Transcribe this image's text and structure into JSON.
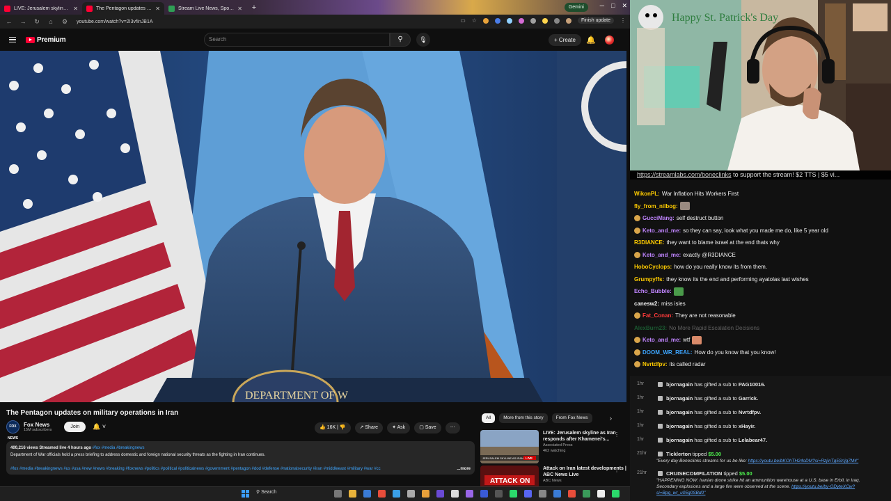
{
  "browser": {
    "tabs": [
      {
        "label": "LIVE: Jerusalem skyline as Iran",
        "active": false
      },
      {
        "label": "The Pentagon updates on m",
        "active": true
      },
      {
        "label": "Stream Live News, Sports,",
        "active": false
      }
    ],
    "gemini_label": "Gemini",
    "url": "youtube.com/watch?v=2I3vfInJB1A",
    "finish_update": "Finish update"
  },
  "youtube": {
    "logo_text": "Premium",
    "search_placeholder": "Search",
    "create_label": "Create"
  },
  "video": {
    "title": "The Pentagon updates on military operations in Iran",
    "seal_text": "DEPARTMENT OF W"
  },
  "channel": {
    "logo_text": "FOX NEWS",
    "name": "Fox News",
    "subscribers": "15M subscribers",
    "join_label": "Join"
  },
  "actions": {
    "likes": "16K",
    "share": "Share",
    "ask": "Ask",
    "save": "Save"
  },
  "description": {
    "meta": "400,216 views  Streamed live 4 hours ago",
    "meta_tags": "#fox #media #breakingnews",
    "text": "Department of War officials hold a press briefing to address domestic and foreign national security threats as the fighting in Iran continues.",
    "tags": "#fox #media #breakingnews #us #usa #new #news #breaking #foxnews #politics #political #politicalnews #government #pentagon #dod #defense #nationalsecurity #iran #middleeast #military #war #cc",
    "more": "...more"
  },
  "related": {
    "chips": [
      "All",
      "More from this story",
      "From Fox News"
    ],
    "items": [
      {
        "title": "LIVE: Jerusalem skyline as Iran responds after Khamenei's...",
        "channel": "Associated Press",
        "meta": "462 watching",
        "thumb_badge": "LIVE",
        "thumb_text": "JERUSALEM SKYLINE AS IRAN"
      },
      {
        "title": "Attack on Iran latest developments | ABC News Live",
        "channel": "ABC News",
        "meta": "",
        "thumb_text": "ATTACK ON"
      }
    ]
  },
  "taskbar": {
    "search_label": "Search"
  },
  "stream": {
    "banner_link": "https://streamlabs.com/boneclinks",
    "banner_text": " to support the stream! $2 TTS | $5 vi...",
    "sign_text": "Happy St. Patrick's Day",
    "chat": [
      {
        "user": "WikonPL:",
        "color": "#ffcc00",
        "text": "War Inflation Hits Workers First",
        "badge": false,
        "emote": false
      },
      {
        "user": "fly_from_nilbog:",
        "color": "#ffcc00",
        "text": "",
        "badge": false,
        "emote": true
      },
      {
        "user": "GucciMang:",
        "color": "#c085ff",
        "text": "self destruct button",
        "badge": true,
        "emote": false
      },
      {
        "user": "Keto_and_me:",
        "color": "#c085ff",
        "text": "so they can say, look what you made me do, like 5 year old",
        "badge": true,
        "emote": false
      },
      {
        "user": "R3DIANCE:",
        "color": "#ffcc00",
        "text": "they want to blame israel at the end thats why",
        "badge": false,
        "emote": false
      },
      {
        "user": "Keto_and_me:",
        "color": "#c085ff",
        "text": "exactly @R3DIANCE",
        "badge": true,
        "emote": false
      },
      {
        "user": "HoboCyclops:",
        "color": "#ffcc00",
        "text": "how do you really know its from them.",
        "badge": false,
        "emote": false
      },
      {
        "user": "Grumpyffs:",
        "color": "#ffcc00",
        "text": "they know its the end and performing ayatolas last wishes",
        "badge": false,
        "emote": false
      },
      {
        "user": "Echo_Bubble:",
        "color": "#c085ff",
        "text": "",
        "badge": false,
        "emote": true
      },
      {
        "user": "canesw2:",
        "color": "#f0f0f0",
        "text": "miss isles",
        "badge": false,
        "emote": false
      },
      {
        "user": "Fat_Conan:",
        "color": "#ff3b3b",
        "text": "They are not reasonable",
        "badge": true,
        "emote": false
      },
      {
        "user": "AlexBurn23:",
        "color": "#2bd96b",
        "text": "No More Rapid Escalation Decisions",
        "badge": false,
        "emote": false,
        "faded": true
      },
      {
        "user": "Keto_and_me:",
        "color": "#c085ff",
        "text": "wtf",
        "badge": true,
        "emote": true
      },
      {
        "user": "DOOM_WR_REAL:",
        "color": "#3ea6ff",
        "text": "How do you know that you know!",
        "badge": true,
        "emote": false
      },
      {
        "user": "Nvrtdfpv:",
        "color": "#ffcc00",
        "text": "its called radar",
        "badge": true,
        "emote": false
      }
    ],
    "events": [
      {
        "time": "1hr",
        "user": "bjornagain",
        "text": " has gifted a sub to ",
        "target": "PAG10016."
      },
      {
        "time": "1hr",
        "user": "bjornagain",
        "text": " has gifted a sub to ",
        "target": "Garrick."
      },
      {
        "time": "1hr",
        "user": "bjornagain",
        "text": " has gifted a sub to ",
        "target": "Nvrtdfpv."
      },
      {
        "time": "1hr",
        "user": "bjornagain",
        "text": " has gifted a sub to ",
        "target": "xHayir."
      },
      {
        "time": "1hr",
        "user": "bjornagain",
        "text": " has gifted a sub to ",
        "target": "Lelabear47."
      }
    ],
    "tips": [
      {
        "time": "21hr",
        "user": "Ticklerton",
        "text": " tipped ",
        "amount": "$5.00",
        "message": "\"Every day Boneclinks streams for us be like: ",
        "link": "https://youtu.be/bKOhTH24oDM?si=RzjinTg5SrIjg7M4\""
      },
      {
        "time": "21hr",
        "user": "CRUISECOMPILATION",
        "text": " tipped ",
        "amount": "$5.00",
        "message": "\"HAPPENING NOW: Iranian drone strike hit an ammunition warehouse at a U.S. base in Erbil, in Iraq.",
        "message2": "Secondary explosions and a large fire were observed at the scene. ",
        "link": "https://youtu.be/by-ODyteXCw?",
        "link2": "si=Bpg_wr_u05g0SBd0\""
      }
    ]
  }
}
